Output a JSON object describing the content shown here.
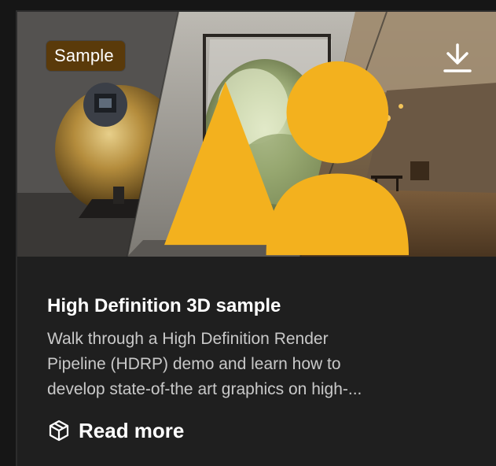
{
  "card": {
    "badge": {
      "label": "Sample",
      "icon": "sample-badge-icon"
    },
    "download_icon": "download-icon",
    "title": "High Definition 3D sample",
    "description_lines": [
      "Walk through a High Definition Render",
      "Pipeline (HDRP) demo and learn how to",
      "develop state-of-the art graphics on high-..."
    ],
    "read_more": {
      "label": "Read more",
      "icon": "package-icon"
    }
  },
  "colors": {
    "page_background": "#161616",
    "card_background": "#1f1f1f",
    "badge_background": "#5a3a0a",
    "badge_icon": "#f3b11e",
    "title_text": "#ffffff",
    "description_text": "#c9c9c9"
  }
}
